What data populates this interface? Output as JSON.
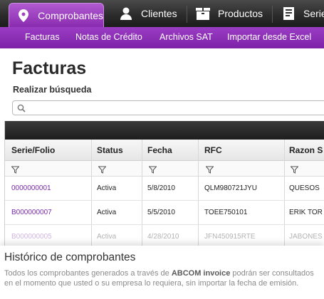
{
  "topnav": {
    "tabs": [
      {
        "label": "Comprobantes",
        "icon": "location-pin-icon",
        "active": true
      },
      {
        "label": "Clientes",
        "icon": "user-icon",
        "active": false
      },
      {
        "label": "Productos",
        "icon": "box-icon",
        "active": false
      },
      {
        "label": "Serie",
        "icon": "document-icon",
        "active": false
      }
    ]
  },
  "subnav": {
    "items": [
      "Facturas",
      "Notas de Crédito",
      "Archivos SAT",
      "Importar desde Excel"
    ]
  },
  "page": {
    "title": "Facturas",
    "search_label": "Realizar búsqueda",
    "search_value": ""
  },
  "grid": {
    "columns": [
      "Serie/Folio",
      "Status",
      "Fecha",
      "RFC",
      "Razon S"
    ],
    "rows": [
      {
        "folio": "0000000001",
        "status": "Activa",
        "fecha": "5/8/2010",
        "rfc": "QLM980721JYU",
        "razon": "QUESOS"
      },
      {
        "folio": "B000000007",
        "status": "Activa",
        "fecha": "5/5/2010",
        "rfc": "TOEE750101",
        "razon": "ERIK TOR"
      },
      {
        "folio": "B000000005",
        "status": "Activa",
        "fecha": "4/28/2010",
        "rfc": "JFN450915RTE",
        "razon": "JABONES"
      }
    ]
  },
  "footer": {
    "title": "Histórico de comprobantes",
    "text_before": "Todos los comprobantes generados  a través de ",
    "brand": "ABCOM invoice",
    "text_after": " podrán ser consultados en el momento que usted o su empresa lo requiera, sin importar la fecha de emisión."
  },
  "colors": {
    "accent": "#8a2bb0",
    "nav_dark": "#2c2c2c",
    "folio_link": "#7a2ba8"
  }
}
